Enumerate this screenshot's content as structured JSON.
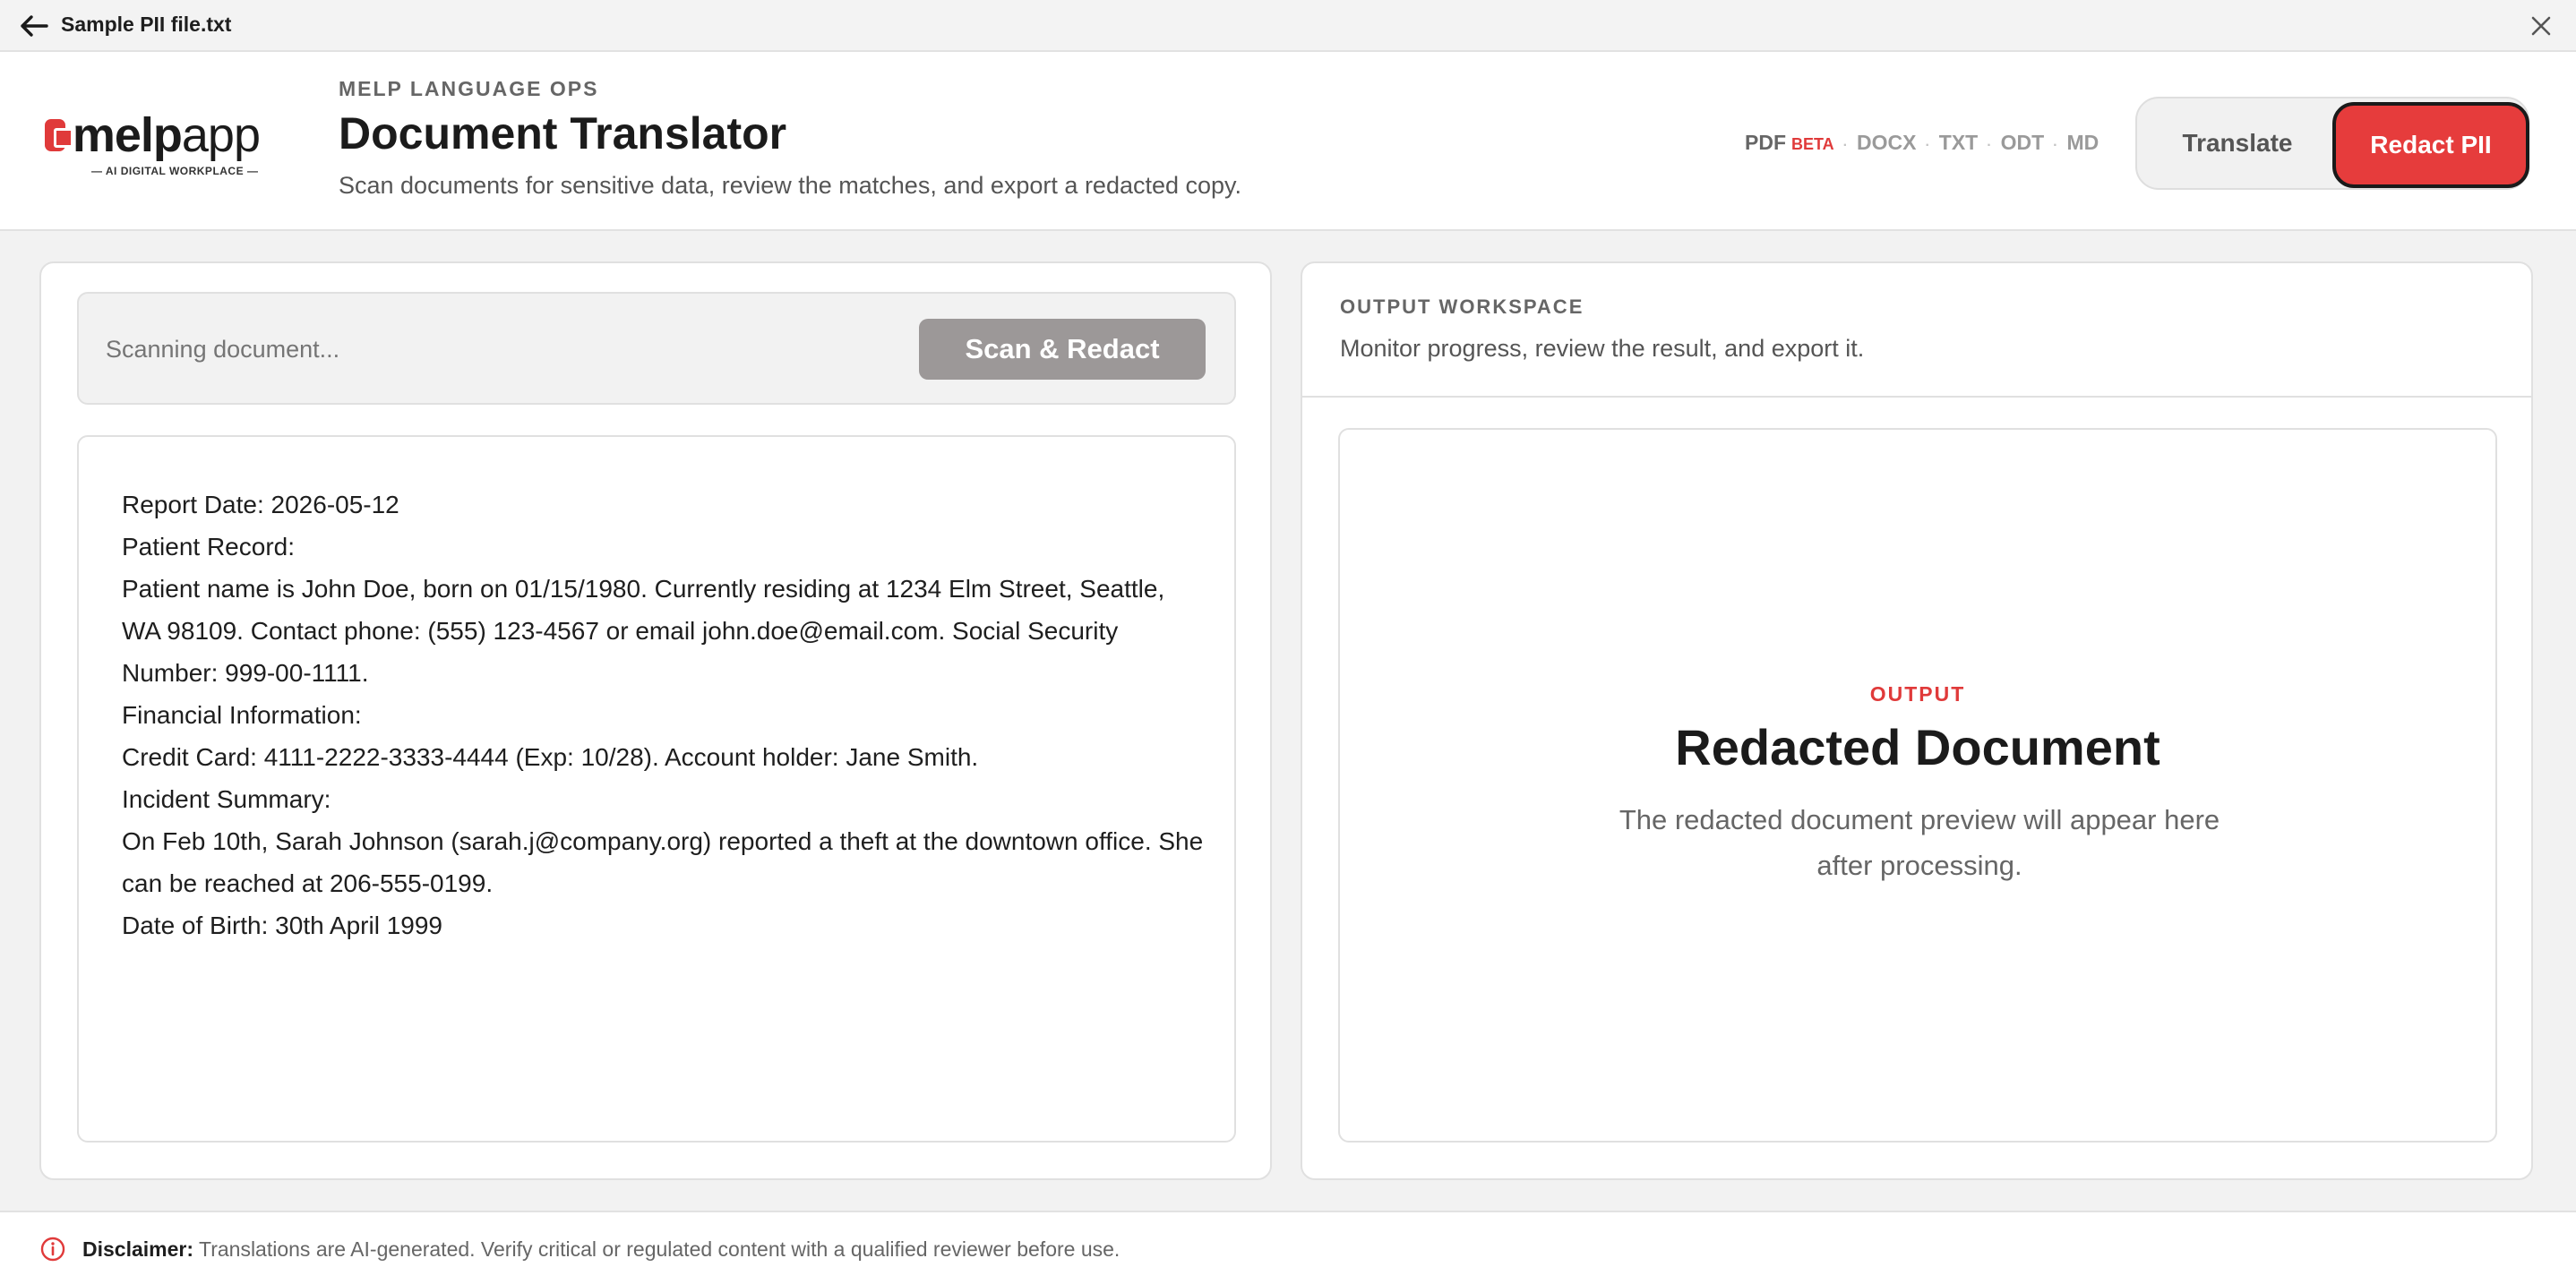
{
  "titlebar": {
    "file_name": "Sample PII file.txt"
  },
  "header": {
    "logo_text_bold": "melp",
    "logo_text_light": "app",
    "logo_sub": "— AI DIGITAL WORKPLACE —",
    "eyebrow": "MELP LANGUAGE OPS",
    "title": "Document Translator",
    "subtitle": "Scan documents for sensitive data, review the matches, and export a redacted copy.",
    "formats": {
      "pdf": "PDF",
      "beta": "BETA",
      "docx": "DOCX",
      "txt": "TXT",
      "odt": "ODT",
      "md": "MD"
    },
    "mode": {
      "translate": "Translate",
      "redact": "Redact PII",
      "active": "redact"
    }
  },
  "input": {
    "scan_placeholder": "Scanning document...",
    "scan_button": "Scan & Redact",
    "lines": [
      "Report Date: 2026-05-12",
      "Patient Record:",
      "Patient name is John Doe, born on 01/15/1980. Currently residing at 1234 Elm Street, Seattle, WA 98109. Contact phone: (555) 123-4567 or email john.doe@email.com. Social Security Number: 999-00-1111.",
      "Financial Information:",
      "Credit Card: 4111-2222-3333-4444 (Exp: 10/28). Account holder: Jane Smith.",
      "Incident Summary:",
      "On Feb 10th, Sarah Johnson (sarah.j@company.org) reported a theft at the downtown office. She can be reached at 206-555-0199.",
      "Date of Birth: 30th April 1999"
    ]
  },
  "workspace": {
    "eyebrow": "OUTPUT WORKSPACE",
    "description": "Monitor progress, review the result, and export it.",
    "output_eyebrow": "OUTPUT",
    "output_title": "Redacted Document",
    "output_description": "The redacted document preview will appear here after processing."
  },
  "footer": {
    "label": "Disclaimer:",
    "text": "Translations are AI-generated. Verify critical or regulated content with a qualified reviewer before use."
  },
  "colors": {
    "accent": "#e63c3c",
    "button_disabled": "#9c9898",
    "background": "#f2f2f2"
  },
  "icons": {
    "back": "arrow-left-icon",
    "close": "close-icon",
    "info": "info-circle-icon"
  }
}
